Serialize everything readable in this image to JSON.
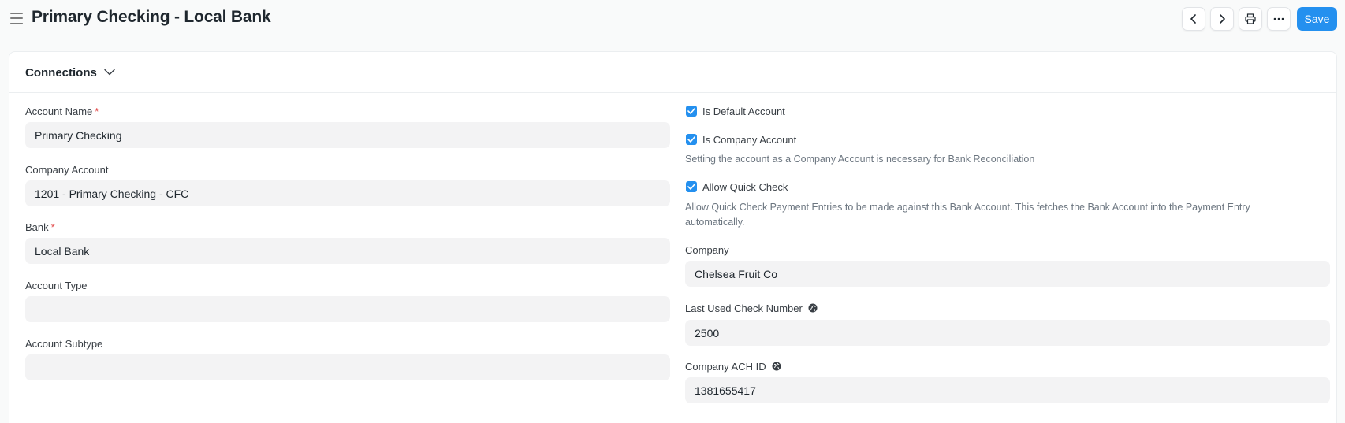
{
  "header": {
    "title": "Primary Checking - Local Bank",
    "save_label": "Save"
  },
  "connections": {
    "label": "Connections"
  },
  "left": {
    "account_name": {
      "label": "Account Name",
      "required": "*",
      "value": "Primary Checking"
    },
    "company_account": {
      "label": "Company Account",
      "value": "1201 - Primary Checking - CFC"
    },
    "bank": {
      "label": "Bank",
      "required": "*",
      "value": "Local Bank"
    },
    "account_type": {
      "label": "Account Type",
      "value": ""
    },
    "account_subtype": {
      "label": "Account Subtype",
      "value": ""
    }
  },
  "right": {
    "is_default": {
      "label": "Is Default Account",
      "checked": true
    },
    "is_company": {
      "label": "Is Company Account",
      "checked": true,
      "help": "Setting the account as a Company Account is necessary for Bank Reconciliation"
    },
    "allow_quick_check": {
      "label": "Allow Quick Check",
      "checked": true,
      "help": "Allow Quick Check Payment Entries to be made against this Bank Account. This fetches the Bank Account into the Payment Entry automatically."
    },
    "company": {
      "label": "Company",
      "value": "Chelsea Fruit Co"
    },
    "last_check_number": {
      "label": "Last Used Check Number",
      "value": "2500"
    },
    "company_ach_id": {
      "label": "Company ACH ID",
      "value": "1381655417"
    }
  },
  "colors": {
    "accent": "#2490ef",
    "required": "#e24c4c"
  }
}
